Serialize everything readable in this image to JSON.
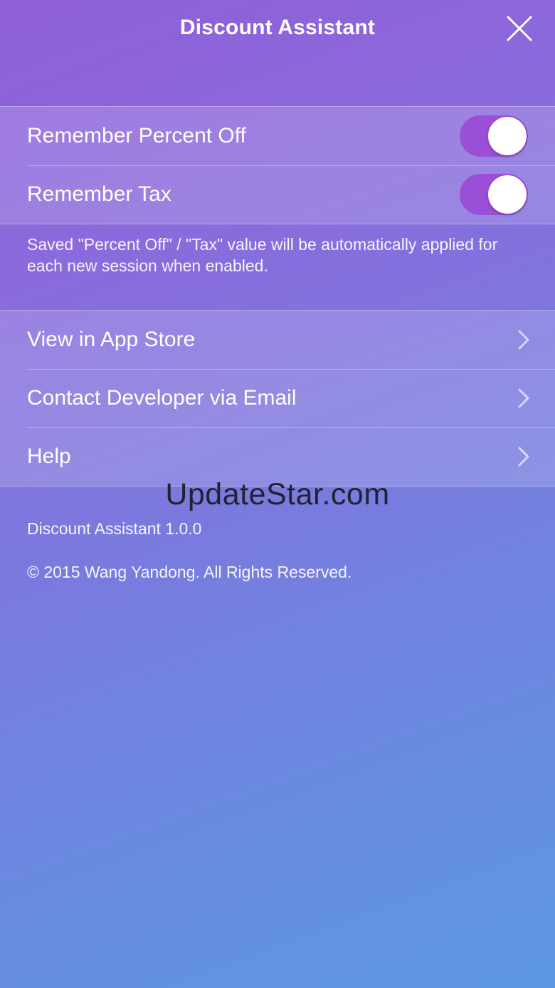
{
  "header": {
    "title": "Discount Assistant",
    "close_icon": "close-icon"
  },
  "settings": {
    "toggles": [
      {
        "label": "Remember Percent Off",
        "enabled": true
      },
      {
        "label": "Remember Tax",
        "enabled": true
      }
    ],
    "footnote": "Saved \"Percent Off\" / \"Tax\" value will be automatically applied for each new session when enabled."
  },
  "links": [
    {
      "label": "View in App Store",
      "icon": "chevron-right-icon"
    },
    {
      "label": "Contact Developer via Email",
      "icon": "chevron-right-icon"
    },
    {
      "label": "Help",
      "icon": "chevron-right-icon"
    }
  ],
  "watermark": "UpdateStar.com",
  "about": {
    "version": "Discount Assistant 1.0.0",
    "copyright": "© 2015 Wang Yandong. All Rights Reserved."
  },
  "colors": {
    "toggle_on": "#9b4fd6",
    "gradient_top": "#8f5ed8",
    "gradient_bottom": "#5c98e2"
  }
}
